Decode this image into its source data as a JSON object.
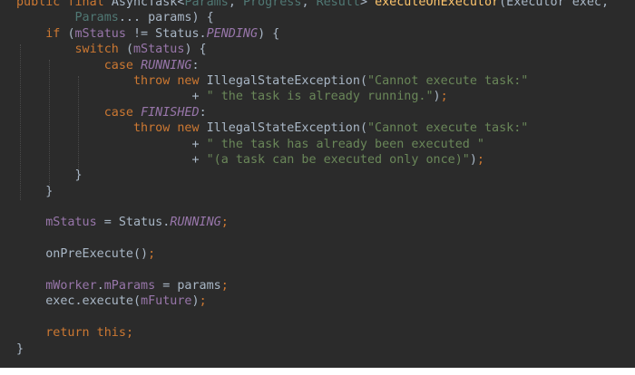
{
  "code": {
    "lines": [
      [
        [
          "keyword",
          "public "
        ],
        [
          "keyword",
          "final "
        ],
        [
          "type",
          "AsyncTask"
        ],
        [
          "plain",
          "<"
        ],
        [
          "generic",
          "Params"
        ],
        [
          "plain",
          ", "
        ],
        [
          "generic",
          "Progress"
        ],
        [
          "plain",
          ", "
        ],
        [
          "generic",
          "Result"
        ],
        [
          "plain",
          "> "
        ],
        [
          "method",
          "executeOnExecutor"
        ],
        [
          "plain",
          "(Executor exec,"
        ]
      ],
      [
        [
          "plain",
          "        "
        ],
        [
          "generic",
          "Params"
        ],
        [
          "plain",
          "... params) {"
        ]
      ],
      [
        [
          "plain",
          "    "
        ],
        [
          "keyword",
          "if "
        ],
        [
          "plain",
          "("
        ],
        [
          "field",
          "mStatus"
        ],
        [
          "plain",
          " != Status."
        ],
        [
          "const",
          "PENDING"
        ],
        [
          "plain",
          ") {"
        ]
      ],
      [
        [
          "plain",
          "        "
        ],
        [
          "keyword",
          "switch "
        ],
        [
          "plain",
          "("
        ],
        [
          "field",
          "mStatus"
        ],
        [
          "plain",
          ") {"
        ]
      ],
      [
        [
          "plain",
          "            "
        ],
        [
          "keyword",
          "case "
        ],
        [
          "const",
          "RUNNING"
        ],
        [
          "plain",
          ":"
        ]
      ],
      [
        [
          "plain",
          "                "
        ],
        [
          "keyword",
          "throw new "
        ],
        [
          "type",
          "IllegalStateException"
        ],
        [
          "plain",
          "("
        ],
        [
          "string",
          "\"Cannot execute task:\""
        ]
      ],
      [
        [
          "plain",
          "                        + "
        ],
        [
          "string",
          "\" the task is already running.\""
        ],
        [
          "plain",
          ")"
        ],
        [
          "punct",
          ";"
        ]
      ],
      [
        [
          "plain",
          "            "
        ],
        [
          "keyword",
          "case "
        ],
        [
          "const",
          "FINISHED"
        ],
        [
          "plain",
          ":"
        ]
      ],
      [
        [
          "plain",
          "                "
        ],
        [
          "keyword",
          "throw new "
        ],
        [
          "type",
          "IllegalStateException"
        ],
        [
          "plain",
          "("
        ],
        [
          "string",
          "\"Cannot execute task:\""
        ]
      ],
      [
        [
          "plain",
          "                        + "
        ],
        [
          "string",
          "\" the task has already been executed \""
        ]
      ],
      [
        [
          "plain",
          "                        + "
        ],
        [
          "string",
          "\"(a task can be executed only once)\""
        ],
        [
          "plain",
          ")"
        ],
        [
          "punct",
          ";"
        ]
      ],
      [
        [
          "plain",
          "        }"
        ]
      ],
      [
        [
          "plain",
          "    }"
        ]
      ],
      [
        [
          "plain",
          ""
        ]
      ],
      [
        [
          "plain",
          "    "
        ],
        [
          "field",
          "mStatus"
        ],
        [
          "plain",
          " = Status."
        ],
        [
          "const",
          "RUNNING"
        ],
        [
          "punct",
          ";"
        ]
      ],
      [
        [
          "plain",
          ""
        ]
      ],
      [
        [
          "plain",
          "    onPreExecute()"
        ],
        [
          "punct",
          ";"
        ]
      ],
      [
        [
          "plain",
          ""
        ]
      ],
      [
        [
          "plain",
          "    "
        ],
        [
          "field",
          "mWorker"
        ],
        [
          "plain",
          "."
        ],
        [
          "field",
          "mParams"
        ],
        [
          "plain",
          " = params"
        ],
        [
          "punct",
          ";"
        ]
      ],
      [
        [
          "plain",
          "    exec.execute("
        ],
        [
          "field",
          "mFuture"
        ],
        [
          "plain",
          ")"
        ],
        [
          "punct",
          ";"
        ]
      ],
      [
        [
          "plain",
          ""
        ]
      ],
      [
        [
          "plain",
          "    "
        ],
        [
          "keyword",
          "return this"
        ],
        [
          "punct",
          ";"
        ]
      ],
      [
        [
          "plain",
          "}"
        ]
      ]
    ]
  }
}
